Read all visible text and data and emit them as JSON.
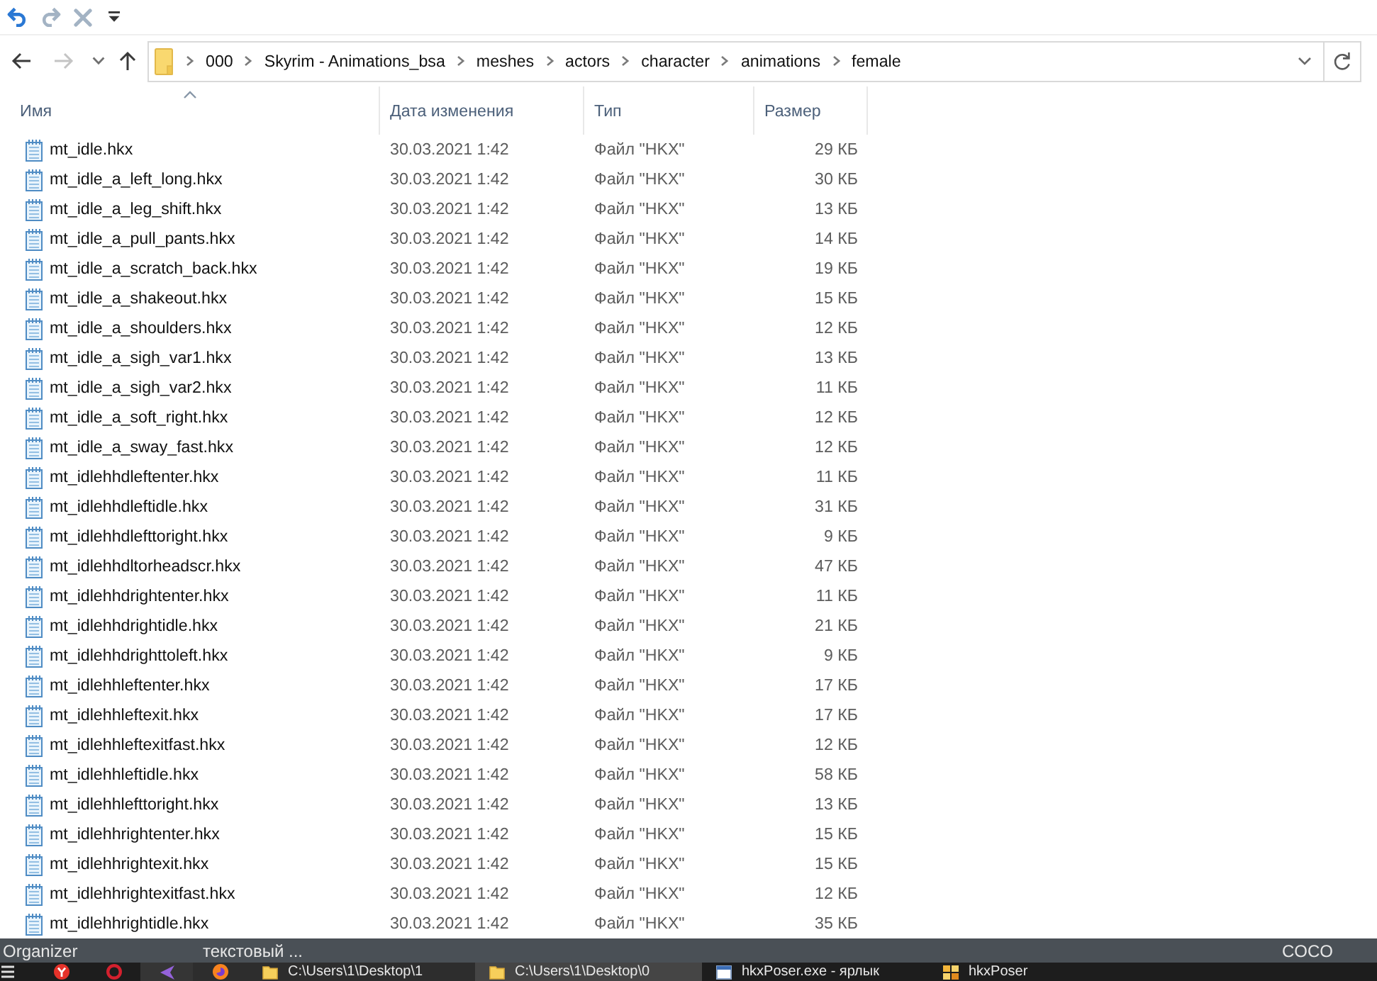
{
  "quick_access_toolbar": [
    {
      "kind": "undo",
      "disabled": false
    },
    {
      "kind": "redo",
      "disabled": true
    },
    {
      "kind": "delete",
      "disabled": true
    },
    {
      "kind": "customize",
      "disabled": false
    }
  ],
  "navigation": [
    {
      "kind": "back",
      "disabled": false
    },
    {
      "kind": "forward",
      "disabled": true
    },
    {
      "kind": "recent",
      "disabled": false
    },
    {
      "kind": "up",
      "disabled": false
    }
  ],
  "address_bar": {
    "path": [
      "000",
      "Skyrim - Animations_bsa",
      "meshes",
      "actors",
      "character",
      "animations",
      "female"
    ]
  },
  "file_list": {
    "columns": [
      {
        "label": "Имя",
        "sorted": true
      },
      {
        "label": "Дата изменения",
        "sorted": false
      },
      {
        "label": "Тип",
        "sorted": false
      },
      {
        "label": "Размер",
        "sorted": false
      }
    ],
    "rows": [
      {
        "name": "mt_idle.hkx",
        "date": "30.03.2021 1:42",
        "type": "Файл \"HKX\"",
        "size": "29 КБ"
      },
      {
        "name": "mt_idle_a_left_long.hkx",
        "date": "30.03.2021 1:42",
        "type": "Файл \"HKX\"",
        "size": "30 КБ"
      },
      {
        "name": "mt_idle_a_leg_shift.hkx",
        "date": "30.03.2021 1:42",
        "type": "Файл \"HKX\"",
        "size": "13 КБ"
      },
      {
        "name": "mt_idle_a_pull_pants.hkx",
        "date": "30.03.2021 1:42",
        "type": "Файл \"HKX\"",
        "size": "14 КБ"
      },
      {
        "name": "mt_idle_a_scratch_back.hkx",
        "date": "30.03.2021 1:42",
        "type": "Файл \"HKX\"",
        "size": "19 КБ"
      },
      {
        "name": "mt_idle_a_shakeout.hkx",
        "date": "30.03.2021 1:42",
        "type": "Файл \"HKX\"",
        "size": "15 КБ"
      },
      {
        "name": "mt_idle_a_shoulders.hkx",
        "date": "30.03.2021 1:42",
        "type": "Файл \"HKX\"",
        "size": "12 КБ"
      },
      {
        "name": "mt_idle_a_sigh_var1.hkx",
        "date": "30.03.2021 1:42",
        "type": "Файл \"HKX\"",
        "size": "13 КБ"
      },
      {
        "name": "mt_idle_a_sigh_var2.hkx",
        "date": "30.03.2021 1:42",
        "type": "Файл \"HKX\"",
        "size": "11 КБ"
      },
      {
        "name": "mt_idle_a_soft_right.hkx",
        "date": "30.03.2021 1:42",
        "type": "Файл \"HKX\"",
        "size": "12 КБ"
      },
      {
        "name": "mt_idle_a_sway_fast.hkx",
        "date": "30.03.2021 1:42",
        "type": "Файл \"HKX\"",
        "size": "12 КБ"
      },
      {
        "name": "mt_idlehhdleftenter.hkx",
        "date": "30.03.2021 1:42",
        "type": "Файл \"HKX\"",
        "size": "11 КБ"
      },
      {
        "name": "mt_idlehhdleftidle.hkx",
        "date": "30.03.2021 1:42",
        "type": "Файл \"HKX\"",
        "size": "31 КБ"
      },
      {
        "name": "mt_idlehhdlefttoright.hkx",
        "date": "30.03.2021 1:42",
        "type": "Файл \"HKX\"",
        "size": "9 КБ"
      },
      {
        "name": "mt_idlehhdltorheadscr.hkx",
        "date": "30.03.2021 1:42",
        "type": "Файл \"HKX\"",
        "size": "47 КБ"
      },
      {
        "name": "mt_idlehhdrightenter.hkx",
        "date": "30.03.2021 1:42",
        "type": "Файл \"HKX\"",
        "size": "11 КБ"
      },
      {
        "name": "mt_idlehhdrightidle.hkx",
        "date": "30.03.2021 1:42",
        "type": "Файл \"HKX\"",
        "size": "21 КБ"
      },
      {
        "name": "mt_idlehhdrighttoleft.hkx",
        "date": "30.03.2021 1:42",
        "type": "Файл \"HKX\"",
        "size": "9 КБ"
      },
      {
        "name": "mt_idlehhleftenter.hkx",
        "date": "30.03.2021 1:42",
        "type": "Файл \"HKX\"",
        "size": "17 КБ"
      },
      {
        "name": "mt_idlehhleftexit.hkx",
        "date": "30.03.2021 1:42",
        "type": "Файл \"HKX\"",
        "size": "17 КБ"
      },
      {
        "name": "mt_idlehhleftexitfast.hkx",
        "date": "30.03.2021 1:42",
        "type": "Файл \"HKX\"",
        "size": "12 КБ"
      },
      {
        "name": "mt_idlehhleftidle.hkx",
        "date": "30.03.2021 1:42",
        "type": "Файл \"HKX\"",
        "size": "58 КБ"
      },
      {
        "name": "mt_idlehhlefttoright.hkx",
        "date": "30.03.2021 1:42",
        "type": "Файл \"HKX\"",
        "size": "13 КБ"
      },
      {
        "name": "mt_idlehhrightenter.hkx",
        "date": "30.03.2021 1:42",
        "type": "Файл \"HKX\"",
        "size": "15 КБ"
      },
      {
        "name": "mt_idlehhrightexit.hkx",
        "date": "30.03.2021 1:42",
        "type": "Файл \"HKX\"",
        "size": "15 КБ"
      },
      {
        "name": "mt_idlehhrightexitfast.hkx",
        "date": "30.03.2021 1:42",
        "type": "Файл \"HKX\"",
        "size": "12 КБ"
      },
      {
        "name": "mt_idlehhrightidle.hkx",
        "date": "30.03.2021 1:42",
        "type": "Файл \"HKX\"",
        "size": "35 КБ"
      }
    ]
  },
  "upper_taskbar": {
    "items": [
      "Organizer",
      "текстовый ..."
    ],
    "right_item": "COCO"
  },
  "taskbar": {
    "pinned": [
      {
        "kind": "menu",
        "running": false,
        "active": false
      },
      {
        "kind": "badge",
        "running": false,
        "active": false
      },
      {
        "kind": "ring",
        "running": false,
        "active": false
      },
      {
        "kind": "triangle",
        "running": false,
        "active": true
      },
      {
        "kind": "globe",
        "running": true,
        "active": false
      }
    ],
    "windows": [
      {
        "label": "C:\\Users\\1\\Desktop\\1",
        "kind": "folder",
        "running": true,
        "active": false
      },
      {
        "label": "C:\\Users\\1\\Desktop\\0",
        "kind": "folder",
        "running": true,
        "active": true
      },
      {
        "label": "hkxPoser.exe - ярлык",
        "kind": "window",
        "running": false,
        "active": false
      },
      {
        "label": "hkxPoser",
        "kind": "tiles",
        "running": false,
        "active": false
      }
    ]
  }
}
